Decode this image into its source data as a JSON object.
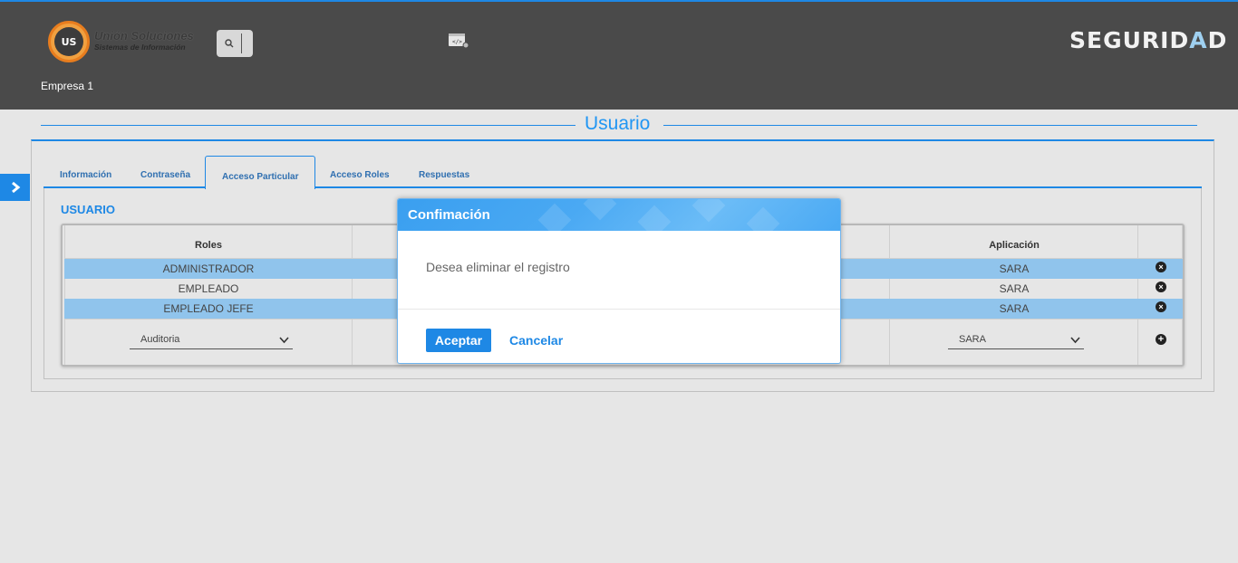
{
  "header": {
    "logo_title": "Unión Soluciones",
    "logo_subtitle": "Sistemas de Información",
    "logo_mark": "US",
    "brand_left": "SEGURID",
    "brand_accent": "A",
    "brand_right": "D",
    "empresa": "Empresa 1",
    "icons": [
      "search-icon",
      "app-settings-icon"
    ]
  },
  "page": {
    "title": "Usuario"
  },
  "tabs": [
    "Información",
    "Contraseña",
    "Acceso Particular",
    "Acceso Roles",
    "Respuestas"
  ],
  "active_tab": "Acceso Particular",
  "section_title": "USUARIO",
  "table": {
    "headers": {
      "roles": "Roles",
      "aplicacion": "Aplicación"
    },
    "rows": [
      {
        "rol": "ADMINISTRADOR",
        "app": "SARA",
        "selected": true
      },
      {
        "rol": "EMPLEADO",
        "app": "SARA",
        "selected": false
      },
      {
        "rol": "EMPLEADO JEFE",
        "app": "SARA",
        "selected": true
      }
    ],
    "new_row": {
      "rol_select": "Auditoria",
      "app_select": "SARA"
    }
  },
  "modal": {
    "title": "Confimación",
    "message": "Desea eliminar el registro",
    "ok_label": "Aceptar",
    "cancel_label": "Cancelar"
  },
  "colors": {
    "accent": "#1e88e5",
    "header_bg": "#4a4a4a",
    "row_selected": "#90c4ec"
  }
}
